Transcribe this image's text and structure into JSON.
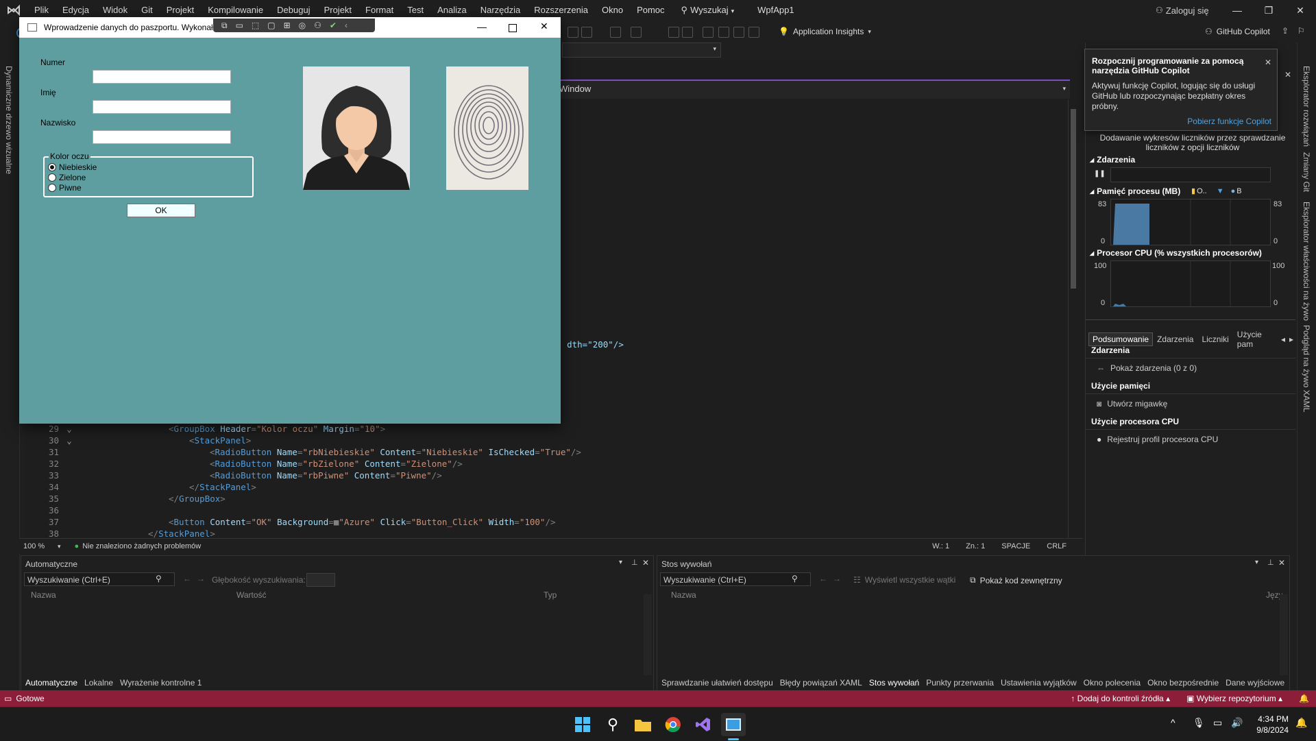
{
  "menu": {
    "items": [
      "Plik",
      "Edycja",
      "Widok",
      "Git",
      "Projekt",
      "Kompilowanie",
      "Debuguj",
      "Projekt",
      "Format",
      "Test",
      "Analiza",
      "Narzędzia",
      "Rozszerzenia",
      "Okno",
      "Pomoc"
    ],
    "search_label": "Wyszukaj",
    "solution": "WpfApp1",
    "login": "Zaloguj się"
  },
  "toolbar": {
    "app_insights": "Application Insights",
    "copilot": "GitHub Copilot",
    "tab_prefix": "Pr"
  },
  "left_rail": {
    "label": "Dynamiczne drzewo wizualne"
  },
  "right_rail": {
    "labels": [
      "Eksplorator rozwiązań",
      "Zmiany Git",
      "Eksplorator właściwości na żywo",
      "Podgląd na żywo XAML"
    ]
  },
  "editor": {
    "breadcrumb": "Window",
    "partial_line": "dth=\"200\"/>",
    "lines": [
      {
        "n": "29",
        "indent": 1,
        "parts": [
          [
            "p",
            "<"
          ],
          [
            "t",
            "GroupBox"
          ],
          [
            "a",
            " Header"
          ],
          [
            "p",
            "="
          ],
          [
            "v",
            "\"Kolor oczu\""
          ],
          [
            "a",
            " Margin"
          ],
          [
            "p",
            "="
          ],
          [
            "v",
            "\"10\""
          ],
          [
            "p",
            ">"
          ]
        ]
      },
      {
        "n": "30",
        "indent": 2,
        "parts": [
          [
            "p",
            "<"
          ],
          [
            "t",
            "StackPanel"
          ],
          [
            "p",
            ">"
          ]
        ]
      },
      {
        "n": "31",
        "indent": 3,
        "parts": [
          [
            "p",
            "<"
          ],
          [
            "t",
            "RadioButton"
          ],
          [
            "a",
            " Name"
          ],
          [
            "p",
            "="
          ],
          [
            "v",
            "\"rbNiebieskie\""
          ],
          [
            "a",
            " Content"
          ],
          [
            "p",
            "="
          ],
          [
            "v",
            "\"Niebieskie\""
          ],
          [
            "a",
            " IsChecked"
          ],
          [
            "p",
            "="
          ],
          [
            "v",
            "\"True\""
          ],
          [
            "p",
            "/>"
          ]
        ]
      },
      {
        "n": "32",
        "indent": 3,
        "parts": [
          [
            "p",
            "<"
          ],
          [
            "t",
            "RadioButton"
          ],
          [
            "a",
            " Name"
          ],
          [
            "p",
            "="
          ],
          [
            "v",
            "\"rbZielone\""
          ],
          [
            "a",
            " Content"
          ],
          [
            "p",
            "="
          ],
          [
            "v",
            "\"Zielone\""
          ],
          [
            "p",
            "/>"
          ]
        ]
      },
      {
        "n": "33",
        "indent": 3,
        "parts": [
          [
            "p",
            "<"
          ],
          [
            "t",
            "RadioButton"
          ],
          [
            "a",
            " Name"
          ],
          [
            "p",
            "="
          ],
          [
            "v",
            "\"rbPiwne\""
          ],
          [
            "a",
            " Content"
          ],
          [
            "p",
            "="
          ],
          [
            "v",
            "\"Piwne\""
          ],
          [
            "p",
            "/>"
          ]
        ]
      },
      {
        "n": "34",
        "indent": 2,
        "parts": [
          [
            "p",
            "</"
          ],
          [
            "t",
            "StackPanel"
          ],
          [
            "p",
            ">"
          ]
        ]
      },
      {
        "n": "35",
        "indent": 1,
        "parts": [
          [
            "p",
            "</"
          ],
          [
            "t",
            "GroupBox"
          ],
          [
            "p",
            ">"
          ]
        ]
      },
      {
        "n": "36",
        "indent": 0,
        "parts": []
      },
      {
        "n": "37",
        "indent": 1,
        "parts": [
          [
            "p",
            "<"
          ],
          [
            "t",
            "Button"
          ],
          [
            "a",
            " Content"
          ],
          [
            "p",
            "="
          ],
          [
            "v",
            "\"OK\""
          ],
          [
            "a",
            " Background"
          ],
          [
            "p",
            "="
          ],
          [
            "p",
            "■"
          ],
          [
            "v",
            "\"Azure\""
          ],
          [
            "a",
            " Click"
          ],
          [
            "p",
            "="
          ],
          [
            "v",
            "\"Button_Click\""
          ],
          [
            "a",
            " Width"
          ],
          [
            "p",
            "="
          ],
          [
            "v",
            "\"100\""
          ],
          [
            "p",
            "/>"
          ]
        ]
      },
      {
        "n": "38",
        "indent": 0,
        "parts": [
          [
            "p",
            "</"
          ],
          [
            "t",
            "StackPanel"
          ],
          [
            "p",
            ">"
          ]
        ]
      }
    ],
    "status": {
      "zoom": "100 %",
      "problems": "Nie znaleziono żadnych problemów",
      "line": "W.: 1",
      "col": "Zn.: 1",
      "spaces": "SPACJE",
      "eol": "CRLF"
    }
  },
  "copilot_popup": {
    "title": "Rozpocznij programowanie za pomocą narzędzia GitHub Copilot",
    "body": "Aktywuj funkcję Copilot, logując się do usługi GitHub lub rozpoczynając bezpłatny okres próbny.",
    "link": "Pobierz funkcje Copilot"
  },
  "diagnostics": {
    "hint": "Dodawanie wykresów liczników przez sprawdzanie liczników z opcji liczników",
    "events_title": "Zdarzenia",
    "memory_title": "Pamięć procesu (MB)",
    "memory_legend": [
      "O..",
      "B"
    ],
    "memory_max": "83",
    "memory_min": "0",
    "cpu_title": "Procesor CPU (% wszystkich procesorów)",
    "cpu_max": "100",
    "cpu_min": "0",
    "tabs": [
      "Podsumowanie",
      "Zdarzenia",
      "Liczniki",
      "Użycie pam"
    ],
    "sec_events": "Zdarzenia",
    "show_events": "Pokaż zdarzenia (0 z 0)",
    "sec_memory": "Użycie pamięci",
    "snapshot": "Utwórz migawkę",
    "sec_cpu": "Użycie procesora CPU",
    "cpu_profile": "Rejestruj profil procesora CPU"
  },
  "autos": {
    "title": "Automatyczne",
    "search": "Wyszukiwanie (Ctrl+E)",
    "depth": "Głębokość wyszukiwania:",
    "cols": [
      "Nazwa",
      "Wartość",
      "Typ"
    ],
    "tabs": [
      "Automatyczne",
      "Lokalne",
      "Wyrażenie kontrolne 1"
    ]
  },
  "callstack": {
    "title": "Stos wywołań",
    "search": "Wyszukiwanie (Ctrl+E)",
    "threads": "Wyświetl wszystkie wątki",
    "external": "Pokaż kod zewnętrzny",
    "cols": [
      "Nazwa",
      "Język"
    ],
    "tabs": [
      "Sprawdzanie ułatwień dostępu",
      "Błędy powiązań XAML",
      "Stos wywołań",
      "Punkty przerwania",
      "Ustawienia wyjątków",
      "Okno polecenia",
      "Okno bezpośrednie",
      "Dane wyjściowe"
    ]
  },
  "statusbar": {
    "ready": "Gotowe",
    "source_control": "Dodaj do kontroli źródła",
    "repo": "Wybierz repozytorium"
  },
  "taskbar": {
    "time": "4:34 PM",
    "date": "9/8/2024"
  },
  "wpf": {
    "title": "Wprowadzenie danych do paszportu. Wykonał:",
    "label_number": "Numer",
    "label_first": "Imię",
    "label_last": "Nazwisko",
    "group_header": "Kolor oczu",
    "radios": [
      "Niebieskie",
      "Zielone",
      "Piwne"
    ],
    "ok": "OK"
  },
  "colors": {
    "accent": "#7a4fbf",
    "status_bar": "#8c1e3a",
    "wpf_bg": "#5f9ea0"
  }
}
